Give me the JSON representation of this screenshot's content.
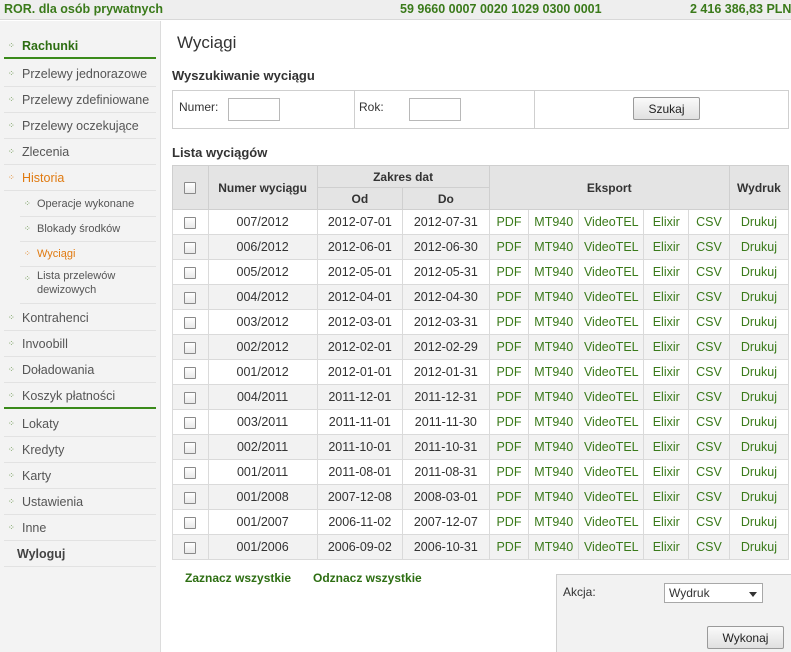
{
  "topbar": {
    "account_name": "ROR. dla osób prywatnych",
    "account_number": "59 9660 0007 0020 1029 0300 0001",
    "balance": "2 416 386,83 PLN"
  },
  "sidebar": {
    "items": [
      {
        "label": "Rachunki"
      },
      {
        "label": "Przelewy jednorazowe"
      },
      {
        "label": "Przelewy zdefiniowane"
      },
      {
        "label": "Przelewy oczekujące"
      },
      {
        "label": "Zlecenia"
      },
      {
        "label": "Historia"
      },
      {
        "label": "Operacje wykonane"
      },
      {
        "label": "Blokady środków"
      },
      {
        "label": "Wyciągi"
      },
      {
        "label": "Lista przelewów dewizowych"
      },
      {
        "label": "Kontrahenci"
      },
      {
        "label": "Invoobill"
      },
      {
        "label": "Doładowania"
      },
      {
        "label": "Koszyk płatności"
      },
      {
        "label": "Lokaty"
      },
      {
        "label": "Kredyty"
      },
      {
        "label": "Karty"
      },
      {
        "label": "Ustawienia"
      },
      {
        "label": "Inne"
      },
      {
        "label": "Wyloguj"
      }
    ]
  },
  "page": {
    "title": "Wyciągi"
  },
  "search": {
    "title": "Wyszukiwanie wyciągu",
    "number_label": "Numer:",
    "number_value": "",
    "year_label": "Rok:",
    "year_value": "",
    "submit_label": "Szukaj"
  },
  "list": {
    "title": "Lista wyciągów",
    "headers": {
      "number": "Numer wyciągu",
      "date_range": "Zakres dat",
      "from": "Od",
      "to": "Do",
      "export": "Eksport",
      "print": "Wydruk"
    },
    "rows": [
      {
        "number": "007/2012",
        "from": "2012-07-01",
        "to": "2012-07-31"
      },
      {
        "number": "006/2012",
        "from": "2012-06-01",
        "to": "2012-06-30"
      },
      {
        "number": "005/2012",
        "from": "2012-05-01",
        "to": "2012-05-31"
      },
      {
        "number": "004/2012",
        "from": "2012-04-01",
        "to": "2012-04-30"
      },
      {
        "number": "003/2012",
        "from": "2012-03-01",
        "to": "2012-03-31"
      },
      {
        "number": "002/2012",
        "from": "2012-02-01",
        "to": "2012-02-29"
      },
      {
        "number": "001/2012",
        "from": "2012-01-01",
        "to": "2012-01-31"
      },
      {
        "number": "004/2011",
        "from": "2011-12-01",
        "to": "2011-12-31"
      },
      {
        "number": "003/2011",
        "from": "2011-11-01",
        "to": "2011-11-30"
      },
      {
        "number": "002/2011",
        "from": "2011-10-01",
        "to": "2011-10-31"
      },
      {
        "number": "001/2011",
        "from": "2011-08-01",
        "to": "2011-08-31"
      },
      {
        "number": "001/2008",
        "from": "2007-12-08",
        "to": "2008-03-01"
      },
      {
        "number": "001/2007",
        "from": "2006-11-02",
        "to": "2007-12-07"
      },
      {
        "number": "001/2006",
        "from": "2006-09-02",
        "to": "2006-10-31"
      }
    ],
    "export_links": [
      "PDF",
      "MT940",
      "VideoTEL",
      "Elixir",
      "CSV"
    ],
    "print_link": "Drukuj"
  },
  "bulk": {
    "select_all": "Zaznacz wszystkie",
    "deselect_all": "Odznacz wszystkie"
  },
  "action": {
    "label": "Akcja:",
    "selected": "Wydruk",
    "submit_label": "Wykonaj"
  },
  "colors": {
    "brand_green": "#3a7a1a",
    "accent_orange": "#e07a10"
  }
}
